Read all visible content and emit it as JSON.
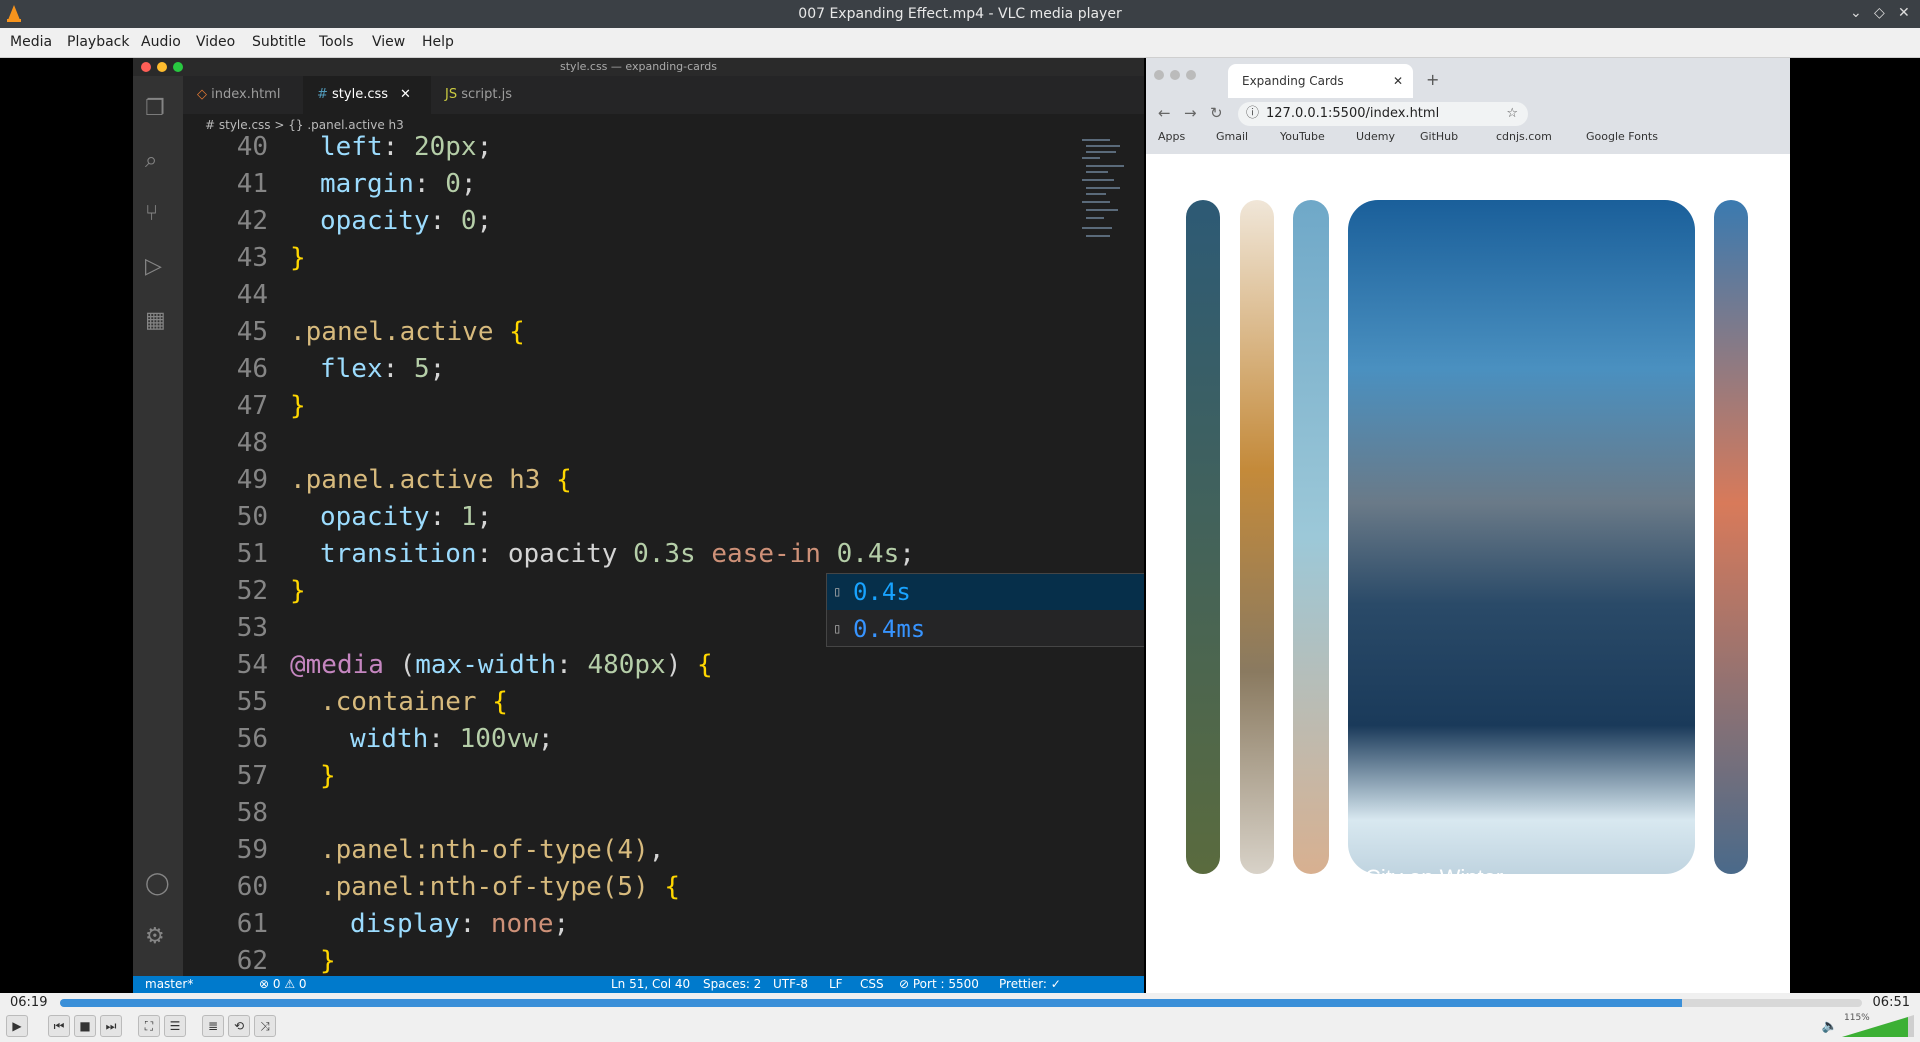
{
  "window": {
    "title": "007 Expanding Effect.mp4 - VLC media player"
  },
  "menu": [
    "Media",
    "Playback",
    "Audio",
    "Video",
    "Subtitle",
    "Tools",
    "View",
    "Help"
  ],
  "vscode": {
    "window_title": "style.css — expanding-cards",
    "tabs": [
      {
        "label": "index.html"
      },
      {
        "label": "style.css"
      },
      {
        "label": "script.js"
      }
    ],
    "breadcrumb": "# style.css > {} .panel.active h3",
    "lines": [
      {
        "n": "40",
        "t": "left: 20px;"
      },
      {
        "n": "41",
        "t": "margin: 0;"
      },
      {
        "n": "42",
        "t": "opacity: 0;"
      },
      {
        "n": "43",
        "t": "}"
      },
      {
        "n": "44",
        "t": ""
      },
      {
        "n": "45",
        "t": ".panel.active {"
      },
      {
        "n": "46",
        "t": "flex: 5;"
      },
      {
        "n": "47",
        "t": "}"
      },
      {
        "n": "48",
        "t": ""
      },
      {
        "n": "49",
        "t": ".panel.active h3 {"
      },
      {
        "n": "50",
        "t": "opacity: 1;"
      },
      {
        "n": "51",
        "t": "transition: opacity 0.3s ease-in 0.4s;"
      },
      {
        "n": "52",
        "t": "}"
      },
      {
        "n": "53",
        "t": ""
      },
      {
        "n": "54",
        "t": "@media (max-width: 480px) {"
      },
      {
        "n": "55",
        "t": ".container {"
      },
      {
        "n": "56",
        "t": "width: 100vw;"
      },
      {
        "n": "57",
        "t": "}"
      },
      {
        "n": "58",
        "t": ""
      },
      {
        "n": "59",
        "t": ".panel:nth-of-type(4),"
      },
      {
        "n": "60",
        "t": ".panel:nth-of-type(5) {"
      },
      {
        "n": "61",
        "t": "display: none;"
      },
      {
        "n": "62",
        "t": "}"
      }
    ],
    "suggestions": [
      "0.4s",
      "0.4ms"
    ],
    "status": {
      "branch": "master*",
      "problems": "⊗ 0 ⚠ 0",
      "position": "Ln 51, Col 40",
      "spaces": "Spaces: 2",
      "encoding": "UTF-8",
      "eol": "LF",
      "language": "CSS",
      "port": "⊘ Port : 5500",
      "prettier": "Prettier: ✓"
    }
  },
  "browser": {
    "tab_title": "Expanding Cards",
    "url": "127.0.0.1:5500/index.html",
    "bookmarks": [
      "Apps",
      "Gmail",
      "YouTube",
      "Udemy",
      "GitHub",
      "cdnjs.com",
      "Google Fonts"
    ],
    "card_title": "City on Winter"
  },
  "player": {
    "elapsed": "06:19",
    "total": "06:51",
    "progress": 0.9,
    "volume": "115%"
  }
}
